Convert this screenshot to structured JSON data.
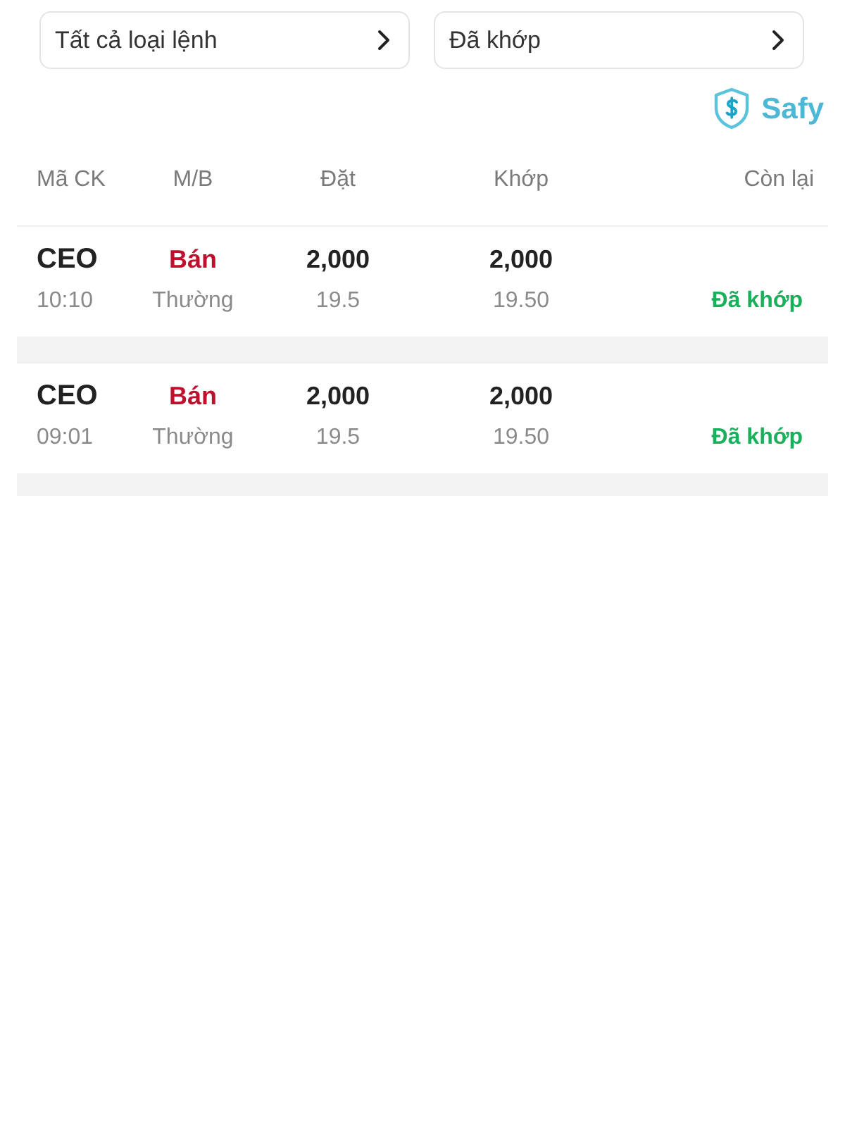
{
  "filters": [
    "Tất cả loại lệnh",
    "Đã khớp"
  ],
  "brand": {
    "name": "Safy"
  },
  "table": {
    "columns": [
      "Mã CK",
      "M/B",
      "Đặt",
      "Khớp",
      "Còn lại"
    ],
    "rows": [
      {
        "symbol": "CEO",
        "time": "10:10",
        "side": {
          "label": "Bán",
          "kind": "sell"
        },
        "order_type": "Thường",
        "order_qty": "2,000",
        "order_price": "19.5",
        "matched_qty": "2,000",
        "matched_price": "19.50",
        "status": {
          "label": "Đã khớp",
          "kind": "matched"
        }
      },
      {
        "symbol": "CEO",
        "time": "09:01",
        "side": {
          "label": "Bán",
          "kind": "sell"
        },
        "order_type": "Thường",
        "order_qty": "2,000",
        "order_price": "19.5",
        "matched_qty": "2,000",
        "matched_price": "19.50",
        "status": {
          "label": "Đã khớp",
          "kind": "matched"
        }
      }
    ]
  }
}
